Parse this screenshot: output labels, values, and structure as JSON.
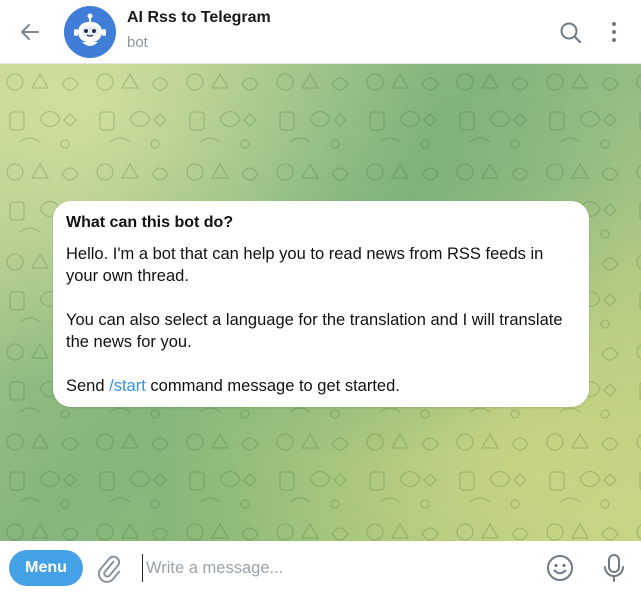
{
  "header": {
    "title": "AI Rss to Telegram",
    "subtitle": "bot",
    "back_icon": "arrow-left-icon",
    "search_icon": "search-icon",
    "more_icon": "vertical-dots-icon",
    "avatar_color": "#3f7dd9"
  },
  "info_card": {
    "title": "What can this bot do?",
    "paragraph_1": "Hello. I'm a bot that can help you to read news from RSS feeds in your own thread.",
    "paragraph_2": "You can also select a language for the translation and I will translate the news for you.",
    "paragraph_3_before": "Send ",
    "paragraph_3_link": "/start",
    "paragraph_3_after": " command message to get started."
  },
  "composer": {
    "menu_label": "Menu",
    "input_value": "",
    "input_placeholder": "Write a message...",
    "attach_icon": "paperclip-icon",
    "emoji_icon": "smiley-icon",
    "mic_icon": "microphone-icon",
    "accent_color": "#45a1e6"
  },
  "colors": {
    "link": "#3390ec",
    "background_green": "#86b67f",
    "background_yellow": "#c5d58a"
  }
}
